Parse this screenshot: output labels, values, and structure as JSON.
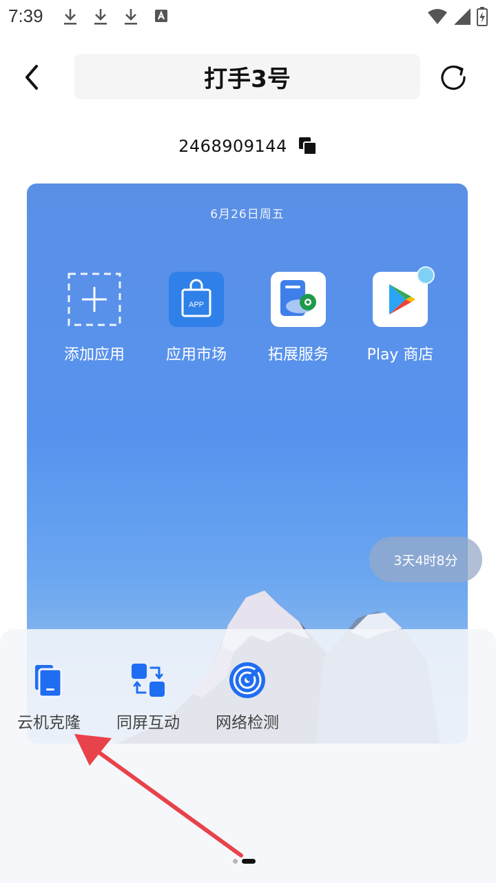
{
  "status_bar": {
    "time": "7:39",
    "icons": [
      "download-icon",
      "download-icon",
      "download-icon",
      "a-notification-icon",
      "wifi-icon",
      "signal-icon",
      "battery-charging-icon"
    ]
  },
  "header": {
    "title": "打手3号",
    "back_icon": "chevron-left-icon",
    "refresh_icon": "refresh-icon"
  },
  "device_id": {
    "value": "2468909144",
    "copy_icon": "copy-icon"
  },
  "screen": {
    "date": "6月26日周五",
    "apps": [
      {
        "label": "添加应用",
        "icon": "add-app-icon"
      },
      {
        "label": "应用市场",
        "icon": "app-market-icon"
      },
      {
        "label": "拓展服务",
        "icon": "extension-service-icon"
      },
      {
        "label": "Play 商店",
        "icon": "play-store-icon"
      }
    ],
    "timer": "3天4时8分"
  },
  "tools": [
    {
      "label": "云机克隆",
      "icon": "cloud-clone-icon"
    },
    {
      "label": "同屏互动",
      "icon": "screen-interact-icon"
    },
    {
      "label": "网络检测",
      "icon": "network-check-icon"
    }
  ],
  "colors": {
    "accent": "#1f6df2",
    "arrow": "#e8424a",
    "screen_blue": "#5793ee"
  }
}
